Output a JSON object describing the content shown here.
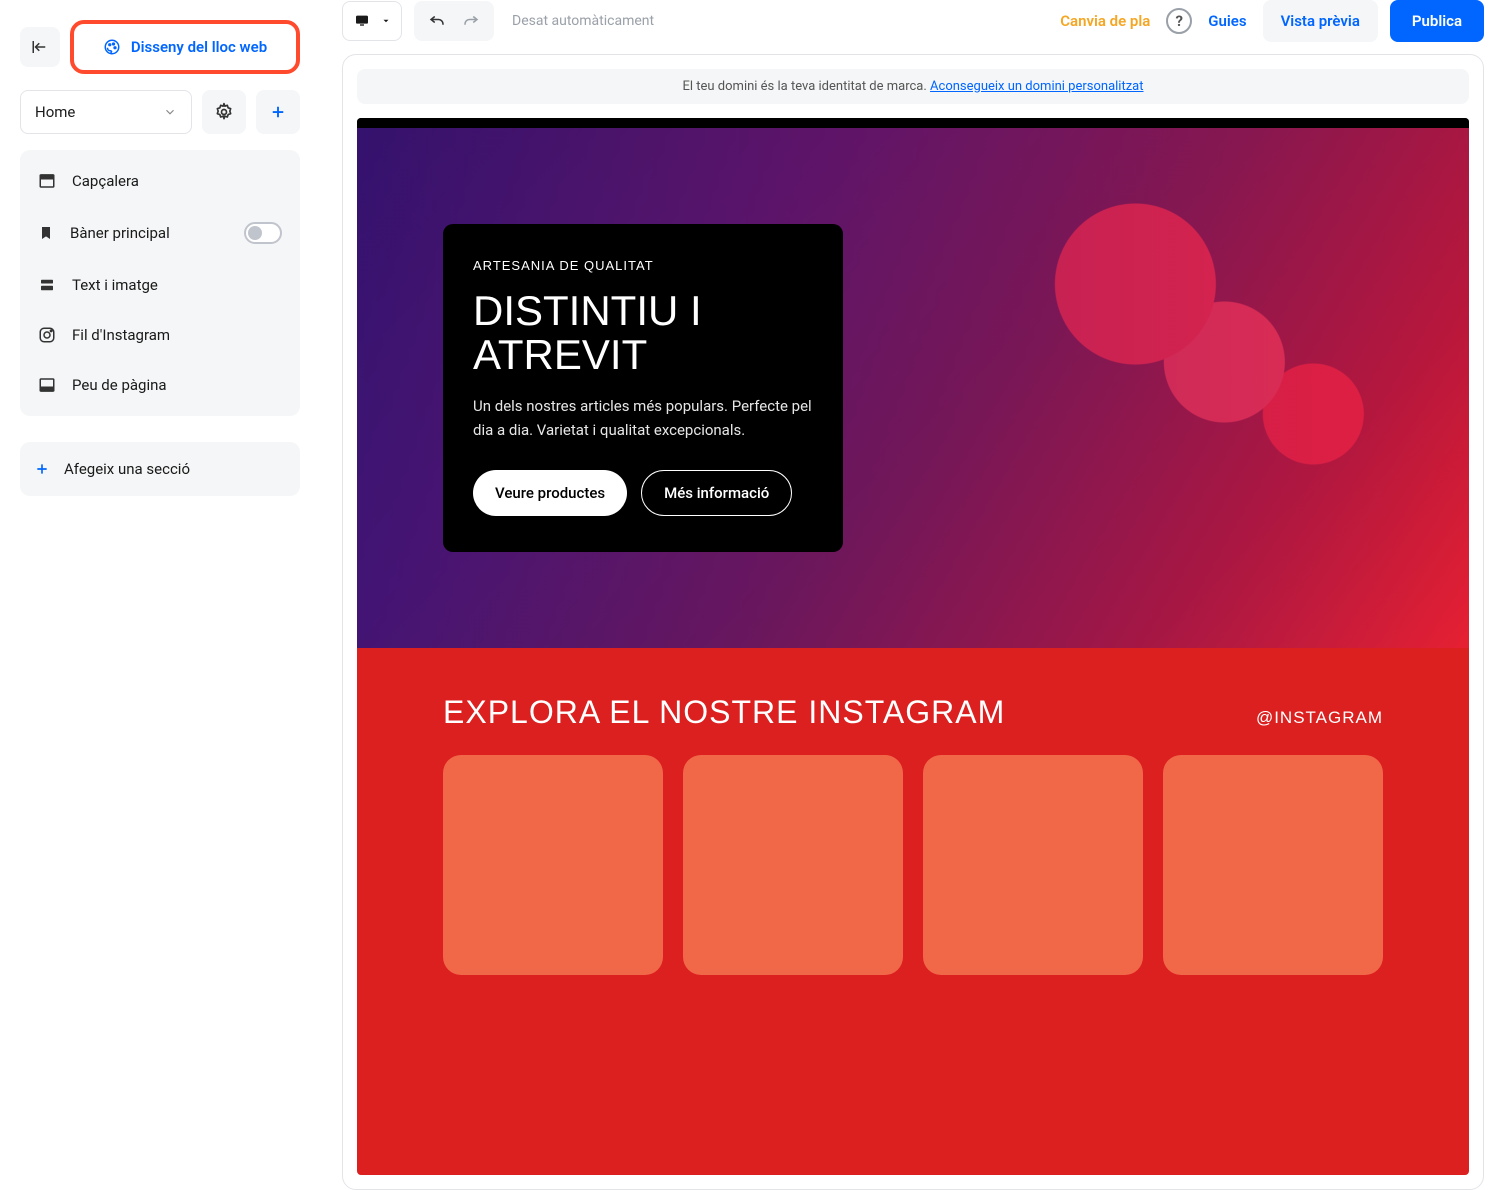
{
  "sidebar": {
    "design_label": "Disseny del lloc web",
    "page_select": "Home",
    "sections": [
      {
        "label": "Capçalera",
        "icon": "header"
      },
      {
        "label": "Bàner principal",
        "icon": "bookmark",
        "toggle": true
      },
      {
        "label": "Text i imatge",
        "icon": "stack"
      },
      {
        "label": "Fil d'Instagram",
        "icon": "instagram"
      },
      {
        "label": "Peu de pàgina",
        "icon": "footer"
      }
    ],
    "add_section": "Afegeix una secció"
  },
  "toolbar": {
    "autosave": "Desat automàticament",
    "change_plan": "Canvia de pla",
    "guides": "Guies",
    "preview": "Vista prèvia",
    "publish": "Publica"
  },
  "domain_banner": {
    "text": "El teu domini és la teva identitat de marca.",
    "link": "Aconsegueix un domini personalitzat"
  },
  "hero": {
    "eyebrow": "ARTESANIA DE QUALITAT",
    "title": "DISTINTIU I ATREVIT",
    "desc": "Un dels nostres articles més populars. Perfecte pel dia a dia. Varietat i qualitat excepcionals.",
    "cta_primary": "Veure productes",
    "cta_secondary": "Més informació"
  },
  "instagram": {
    "title": "EXPLORA EL NOSTRE INSTAGRAM",
    "handle": "@INSTAGRAM"
  }
}
